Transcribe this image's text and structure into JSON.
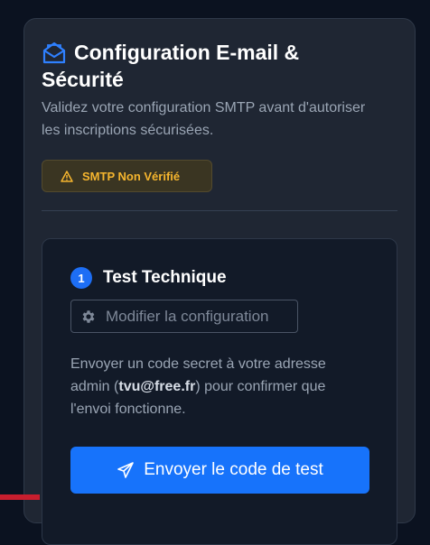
{
  "panel": {
    "title_line1": "Configuration E-mail &",
    "title_line2": "Sécurité",
    "title_icon": "envelope-open-icon",
    "subtitle": "Validez votre configuration SMTP avant d'autoriser les inscriptions sécurisées.",
    "status_badge": {
      "icon": "warning-triangle-icon",
      "label": "SMTP Non Vérifié",
      "color": "#f5b52e"
    }
  },
  "step": {
    "number": "1",
    "title": "Test Technique",
    "config_button": {
      "icon": "gear-icon",
      "label": "Modifier la configuration"
    },
    "description_before": "Envoyer un code secret à votre adresse admin (",
    "admin_email": "tvu@free.fr",
    "description_after": ") pour confirmer que l'envoi fonctionne.",
    "send_button": {
      "icon": "paper-plane-icon",
      "label": "Envoyer le code de test"
    }
  },
  "colors": {
    "accent": "#1773fb",
    "warning": "#f5b52e",
    "background": "#0b1220",
    "panel": "#1f2633"
  }
}
